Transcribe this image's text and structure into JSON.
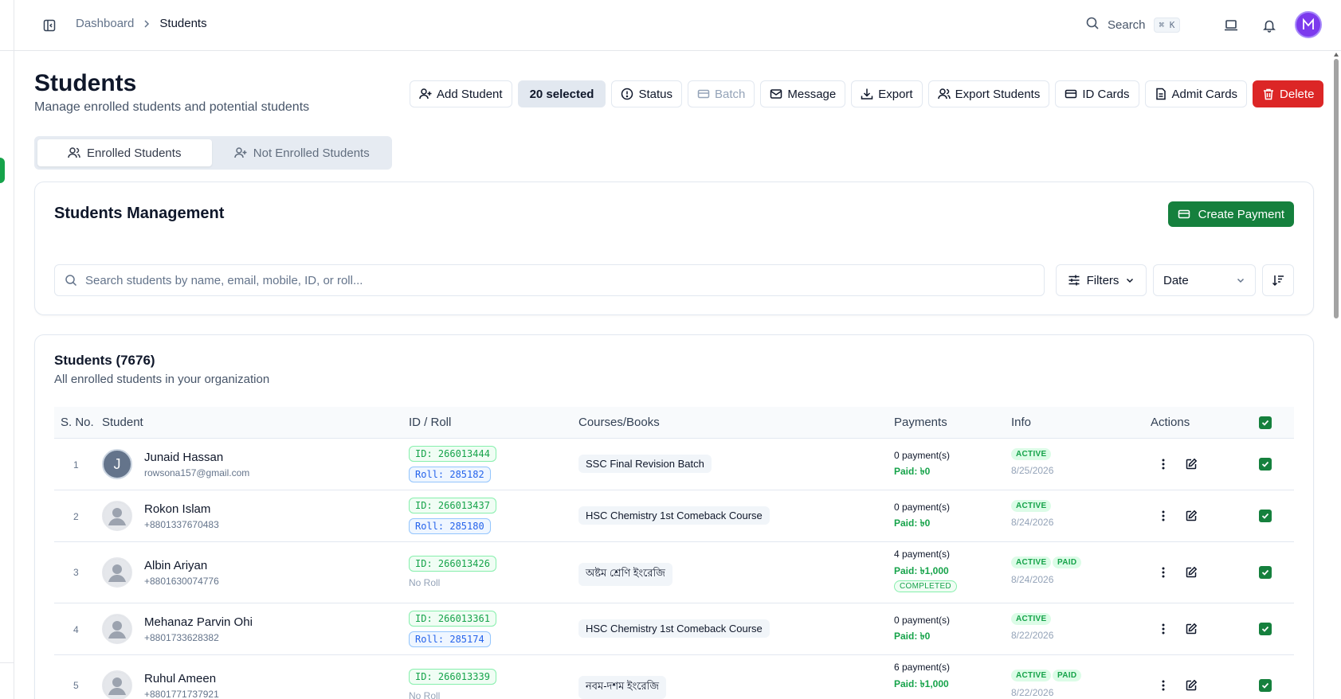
{
  "header": {
    "breadcrumb": [
      "Dashboard",
      "Students"
    ],
    "search_label": "Search",
    "search_shortcut": "⌘ K",
    "avatar_letter": "M"
  },
  "page": {
    "title": "Students",
    "subtitle": "Manage enrolled students and potential students"
  },
  "toolbar": {
    "add_student": "Add Student",
    "selected": "20 selected",
    "status": "Status",
    "batch": "Batch",
    "message": "Message",
    "export": "Export",
    "export_students": "Export Students",
    "id_cards": "ID Cards",
    "admit_cards": "Admit Cards",
    "delete": "Delete"
  },
  "tabs": {
    "enrolled": "Enrolled Students",
    "not_enrolled": "Not Enrolled Students"
  },
  "management": {
    "title": "Students Management",
    "create_payment": "Create Payment",
    "search_placeholder": "Search students by name, email, mobile, ID, or roll...",
    "filters": "Filters",
    "date_select": "Date"
  },
  "list": {
    "title": "Students (7676)",
    "subtitle": "All enrolled students in your organization",
    "columns": {
      "sno": "S. No.",
      "student": "Student",
      "id_roll": "ID / Roll",
      "courses": "Courses/Books",
      "payments": "Payments",
      "info": "Info",
      "actions": "Actions"
    },
    "rows": [
      {
        "sno": "1",
        "initial": "J",
        "name": "Junaid Hassan",
        "contact": "rowsona157@gmail.com",
        "id": "ID: 266013444",
        "roll": "Roll: 285182",
        "course": "SSC Final Revision Batch",
        "payments": "0 payment(s)",
        "paid": "Paid: ৳0",
        "status": "ACTIVE",
        "date": "8/25/2026"
      },
      {
        "sno": "2",
        "name": "Rokon Islam",
        "contact": "+8801337670483",
        "id": "ID: 266013437",
        "roll": "Roll: 285180",
        "course": "HSC Chemistry 1st Comeback Course",
        "payments": "0 payment(s)",
        "paid": "Paid: ৳0",
        "status": "ACTIVE",
        "date": "8/24/2026"
      },
      {
        "sno": "3",
        "name": "Albin Ariyan",
        "contact": "+8801630074776",
        "id": "ID: 266013426",
        "no_roll": "No Roll",
        "course": "অষ্টম শ্রেণি ইংরেজি",
        "payments": "4 payment(s)",
        "paid": "Paid: ৳1,000",
        "completed": "COMPLETED",
        "status": "ACTIVE",
        "paid_badge": "PAID",
        "date": "8/24/2026"
      },
      {
        "sno": "4",
        "name": "Mehanaz Parvin Ohi",
        "contact": "+8801733628382",
        "id": "ID: 266013361",
        "roll": "Roll: 285174",
        "course": "HSC Chemistry 1st Comeback Course",
        "payments": "0 payment(s)",
        "paid": "Paid: ৳0",
        "status": "ACTIVE",
        "date": "8/22/2026"
      },
      {
        "sno": "5",
        "name": "Ruhul Ameen",
        "contact": "+8801771737921",
        "id": "ID: 266013339",
        "no_roll": "No Roll",
        "course": "নবম-দশম ইংরেজি",
        "payments": "6 payment(s)",
        "paid": "Paid: ৳1,000",
        "status": "ACTIVE",
        "paid_badge": "PAID",
        "date": "8/22/2026"
      }
    ]
  },
  "colors": {
    "brand_green": "#15803d",
    "danger": "#dc2626",
    "avatar_purple": "#7c3aed"
  }
}
